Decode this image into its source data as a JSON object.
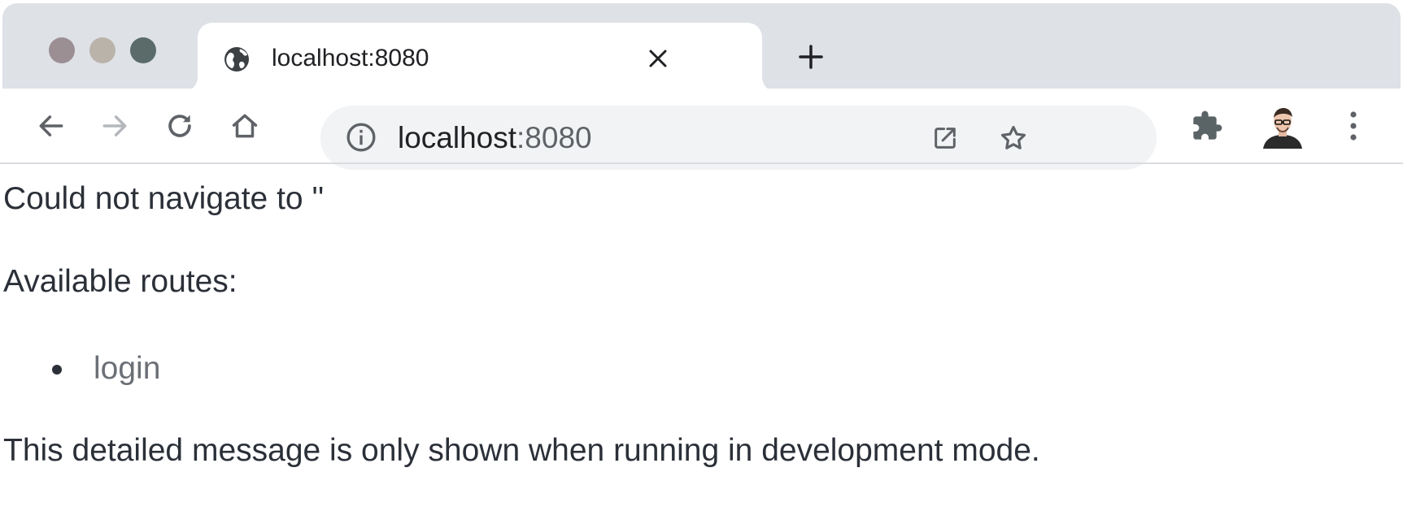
{
  "window": {
    "traffic_colors": {
      "close": "#9b8f94",
      "minimize": "#b9b3aa",
      "maximize": "#5a6b69"
    }
  },
  "tab": {
    "title": "localhost:8080",
    "favicon": "globe-icon"
  },
  "toolbar": {
    "icons": [
      "back-icon",
      "forward-icon",
      "reload-icon",
      "home-icon",
      "extensions-icon",
      "profile-avatar",
      "menu-icon"
    ],
    "address": {
      "host": "localhost",
      "port": ":8080",
      "info_icon": "info-icon",
      "actions": [
        "open-external-icon",
        "star-icon"
      ]
    }
  },
  "page": {
    "error_message": "Could not navigate to ''",
    "routes_heading": "Available routes:",
    "routes": [
      {
        "label": "login"
      }
    ],
    "dev_note": "This detailed message is only shown when running in development mode."
  }
}
